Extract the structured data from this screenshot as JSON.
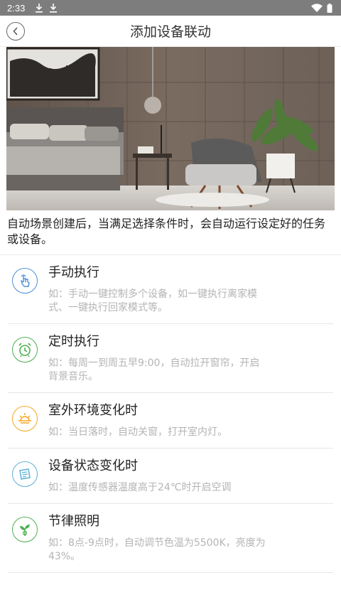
{
  "status_bar": {
    "time": "2:33"
  },
  "nav": {
    "title": "添加设备联动"
  },
  "description": "自动场景创建后，当满足选择条件时，会自动运行设定好的任务或设备。",
  "items": [
    {
      "title": "手动执行",
      "desc": "如：手动一键控制多个设备，如一键执行离家模式、一键执行回家模式等。",
      "icon": "hand-tap-icon",
      "color": "#4a8fd8"
    },
    {
      "title": "定时执行",
      "desc": "如：每周一到周五早9:00，自动拉开窗帘，开启背景音乐。",
      "icon": "alarm-clock-icon",
      "color": "#4caf50"
    },
    {
      "title": "室外环境变化时",
      "desc": "如：当日落时，自动关窗，打开室内灯。",
      "icon": "sunset-icon",
      "color": "#f5a623"
    },
    {
      "title": "设备状态变化时",
      "desc": "如：温度传感器温度高于24℃时开启空调",
      "icon": "device-state-icon",
      "color": "#5bb0d6"
    },
    {
      "title": "节律照明",
      "desc": "如：8点-9点时，自动调节色温为5500K，亮度为43%。",
      "icon": "plant-bulb-icon",
      "color": "#4caf50"
    }
  ]
}
